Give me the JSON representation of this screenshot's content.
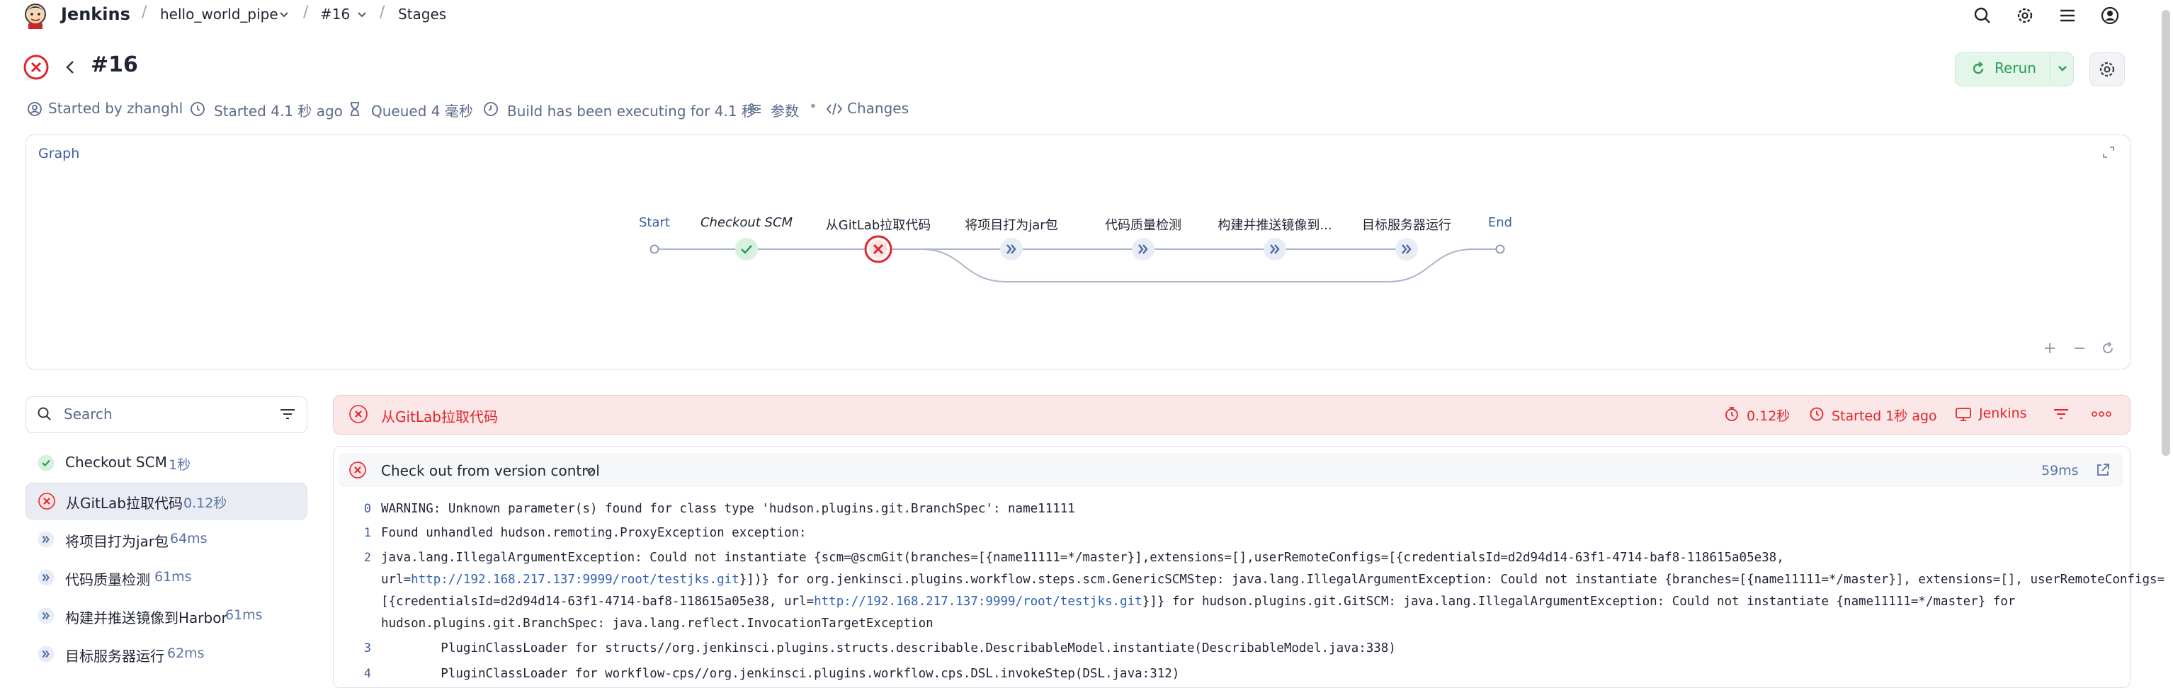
{
  "topbar": {
    "brand": "Jenkins",
    "breadcrumbs": [
      "hello_world_pipe",
      "#16",
      "Stages"
    ]
  },
  "header": {
    "title": "#16",
    "meta": {
      "started_by": "Started by zhanghl",
      "started": "Started 4.1 秒 ago",
      "queued": "Queued 4 毫秒",
      "executing": "Build has been executing for 4.1 秒",
      "params": "参数",
      "changes": "Changes"
    },
    "rerun_label": "Rerun"
  },
  "graph": {
    "title": "Graph",
    "nodes": [
      {
        "label": "Start",
        "status": "start"
      },
      {
        "label": "Checkout SCM",
        "status": "success"
      },
      {
        "label": "从GitLab拉取代码",
        "status": "failed"
      },
      {
        "label": "将项目打为jar包",
        "status": "skipped"
      },
      {
        "label": "代码质量检测",
        "status": "skipped"
      },
      {
        "label": "构建并推送镜像到...",
        "status": "skipped"
      },
      {
        "label": "目标服务器运行",
        "status": "skipped"
      },
      {
        "label": "End",
        "status": "end"
      }
    ]
  },
  "sidebar": {
    "search_placeholder": "Search",
    "stages": [
      {
        "name": "Checkout SCM",
        "duration": "1秒",
        "status": "success"
      },
      {
        "name": "从GitLab拉取代码",
        "duration": "0.12秒",
        "status": "failed",
        "selected": true
      },
      {
        "name": "将项目打为jar包",
        "duration": "64ms",
        "status": "skipped"
      },
      {
        "name": "代码质量检测",
        "duration": "61ms",
        "status": "skipped"
      },
      {
        "name": "构建并推送镜像到Harbor",
        "duration": "61ms",
        "status": "skipped"
      },
      {
        "name": "目标服务器运行",
        "duration": "62ms",
        "status": "skipped"
      }
    ]
  },
  "stage_detail": {
    "name": "从GitLab拉取代码",
    "duration": "0.12秒",
    "started": "Started 1秒 ago",
    "agent": "Jenkins",
    "step": {
      "title": "Check out from version control",
      "duration": "59ms",
      "log": [
        {
          "n": "0",
          "parts": [
            {
              "t": "WARNING: Unknown parameter(s) found for class type 'hudson.plugins.git.BranchSpec': name11111"
            }
          ]
        },
        {
          "n": "1",
          "parts": [
            {
              "t": "Found unhandled hudson.remoting.ProxyException exception:"
            }
          ]
        },
        {
          "n": "2",
          "parts": [
            {
              "t": "java.lang.IllegalArgumentException: Could not instantiate {scm=@scmGit(branches=[{name11111=*/master}],extensions=[],userRemoteConfigs=[{credentialsId=d2d94d14-63f1-4714-baf8-118615a05e38,"
            }
          ]
        },
        {
          "n": "",
          "parts": [
            {
              "t": "url="
            },
            {
              "t": "http://192.168.217.137:9999/root/testjks.git",
              "link": true
            },
            {
              "t": "}])} for org.jenkinsci.plugins.workflow.steps.scm.GenericSCMStep: java.lang.IllegalArgumentException: Could not instantiate {branches=[{name11111=*/master}], extensions=[], userRemoteConfigs="
            }
          ]
        },
        {
          "n": "",
          "parts": [
            {
              "t": "[{credentialsId=d2d94d14-63f1-4714-baf8-118615a05e38, url="
            },
            {
              "t": "http://192.168.217.137:9999/root/testjks.git",
              "link": true
            },
            {
              "t": "}]} for hudson.plugins.git.GitSCM: java.lang.IllegalArgumentException: Could not instantiate {name11111=*/master} for"
            }
          ]
        },
        {
          "n": "",
          "parts": [
            {
              "t": "hudson.plugins.git.BranchSpec: java.lang.reflect.InvocationTargetException"
            }
          ]
        },
        {
          "n": "3",
          "parts": [
            {
              "t": "        PluginClassLoader for structs//org.jenkinsci.plugins.structs.describable.DescribableModel.instantiate(DescribableModel.java:338)"
            }
          ]
        },
        {
          "n": "4",
          "parts": [
            {
              "t": "        PluginClassLoader for workflow-cps//org.jenkinsci.plugins.workflow.cps.DSL.invokeStep(DSL.java:312)"
            }
          ]
        }
      ]
    }
  },
  "colors": {
    "success": "#2e9e59",
    "failed": "#e1242a",
    "skipped_bg": "#e8edf5",
    "skipped_fg": "#4a6aa5",
    "link": "#2f61b7",
    "meta": "#5a6a8a"
  }
}
